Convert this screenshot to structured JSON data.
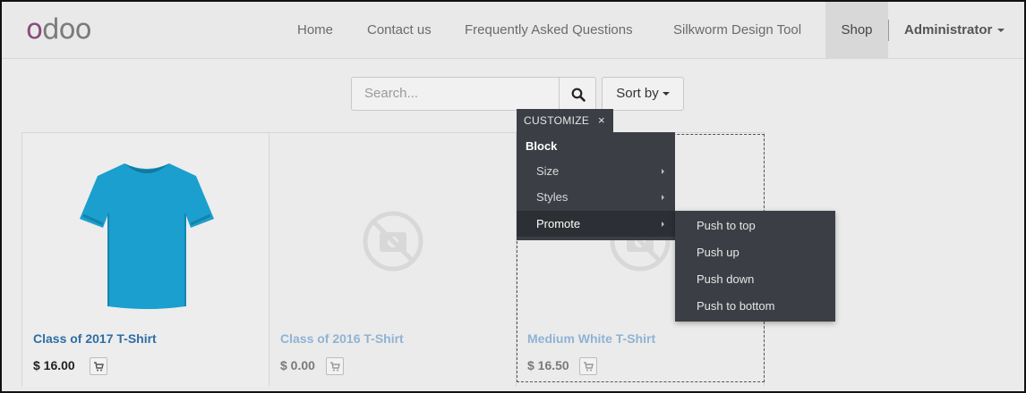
{
  "brand": {
    "logo_first": "o",
    "logo_rest": "doo"
  },
  "nav": {
    "home": "Home",
    "contact": "Contact us",
    "faq": "Frequently Asked Questions",
    "silkworm": "Silkworm Design Tool",
    "shop": "Shop",
    "user": "Administrator"
  },
  "search": {
    "placeholder": "Search...",
    "sort_label": "Sort by"
  },
  "customize": {
    "tab_label": "CUSTOMIZE",
    "close": "×",
    "block_heading": "Block",
    "items": [
      {
        "label": "Size"
      },
      {
        "label": "Styles"
      },
      {
        "label": "Promote"
      }
    ],
    "promote_submenu": [
      "Push to top",
      "Push up",
      "Push down",
      "Push to bottom"
    ]
  },
  "products": [
    {
      "name": "Class of 2017 T-Shirt",
      "price": "$ 16.00"
    },
    {
      "name": "Class of 2016 T-Shirt",
      "price": "$ 0.00"
    },
    {
      "name": "Medium White T-Shirt",
      "price": "$ 16.50"
    }
  ],
  "colors": {
    "brand_purple": "#8a4b7a",
    "link_blue": "#2e6da4",
    "menu_bg": "#3b3f45",
    "shirt_blue": "#1a9fcf"
  }
}
